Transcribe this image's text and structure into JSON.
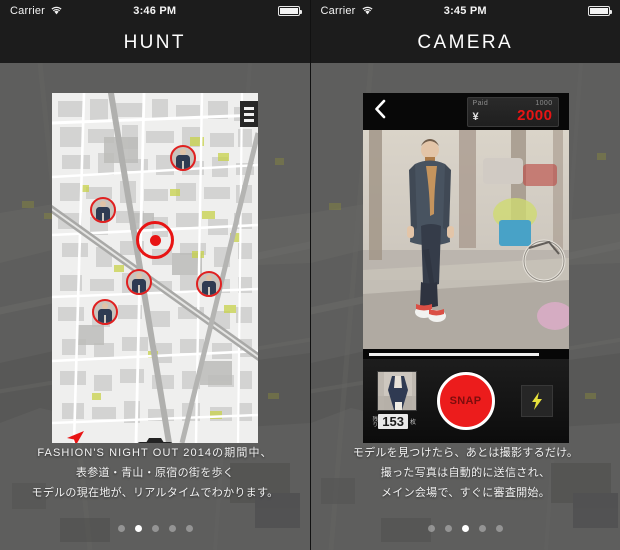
{
  "screens": [
    {
      "id": "hunt",
      "statusbar": {
        "carrier": "Carrier",
        "wifi_icon": "wifi-icon",
        "time": "3:46 PM",
        "battery_icon": "battery-full-icon"
      },
      "title": "HUNT",
      "map": {
        "list_button_icon": "list-lines-icon",
        "locate_button_icon": "location-arrow-icon",
        "camera_button_icon": "camera-icon",
        "user_marker_icon": "current-location-target-icon",
        "pins": [
          {
            "label": "model-pin-1"
          },
          {
            "label": "model-pin-2"
          },
          {
            "label": "model-pin-3"
          },
          {
            "label": "model-pin-4"
          },
          {
            "label": "model-pin-5"
          }
        ]
      },
      "caption": [
        "FASHION'S NIGHT OUT 2014の期間中、",
        "表参道・青山・原宿の街を歩く",
        "モデルの現在地が、リアルタイムでわかります。"
      ],
      "dots": {
        "count": 5,
        "active": 1
      }
    },
    {
      "id": "camera",
      "statusbar": {
        "carrier": "Carrier",
        "wifi_icon": "wifi-icon",
        "time": "3:45 PM",
        "battery_icon": "battery-full-icon"
      },
      "title": "CAMERA",
      "camera": {
        "back_icon": "back-chevron-icon",
        "paid_label": "Paid",
        "paid_value": "1000",
        "currency_symbol": "¥",
        "total_value": "2000",
        "photo_alt": "street-style-model-photo",
        "thumbnail_alt": "last-shot-thumbnail",
        "remaining_label": "残り",
        "remaining_count": "153",
        "remaining_unit": "枚",
        "shutter_label": "SNAP",
        "flash_icon": "flash-bolt-icon"
      },
      "caption": [
        "モデルを見つけたら、あとは撮影するだけ。",
        "撮った写真は自動的に送信され、",
        "メイン会場で、すぐに審査開始。"
      ],
      "dots": {
        "count": 5,
        "active": 2
      }
    }
  ],
  "colors": {
    "accent_red": "#e81414",
    "bar_dark": "#1c1c1c",
    "flash_yellow": "#e8e23c"
  }
}
